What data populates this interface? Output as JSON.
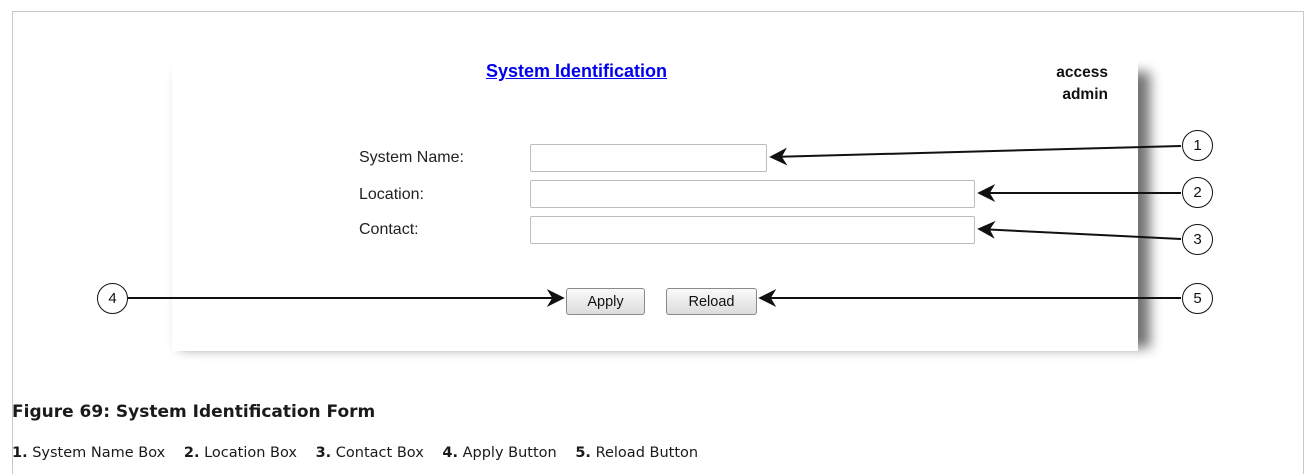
{
  "form": {
    "title": "System Identification",
    "user": {
      "line1": "access",
      "line2": "admin"
    },
    "fields": [
      {
        "label": "System Name:",
        "value": ""
      },
      {
        "label": "Location:",
        "value": ""
      },
      {
        "label": "Contact:",
        "value": ""
      }
    ],
    "buttons": {
      "apply": "Apply",
      "reload": "Reload"
    }
  },
  "callouts": [
    "1",
    "2",
    "3",
    "4",
    "5"
  ],
  "figure": {
    "caption": "Figure 69: System Identification Form",
    "legend": [
      {
        "num": "1.",
        "text": "System Name Box"
      },
      {
        "num": "2.",
        "text": "Location Box"
      },
      {
        "num": "3.",
        "text": "Contact Box"
      },
      {
        "num": "4.",
        "text": "Apply Button"
      },
      {
        "num": "5.",
        "text": "Reload Button"
      }
    ]
  }
}
